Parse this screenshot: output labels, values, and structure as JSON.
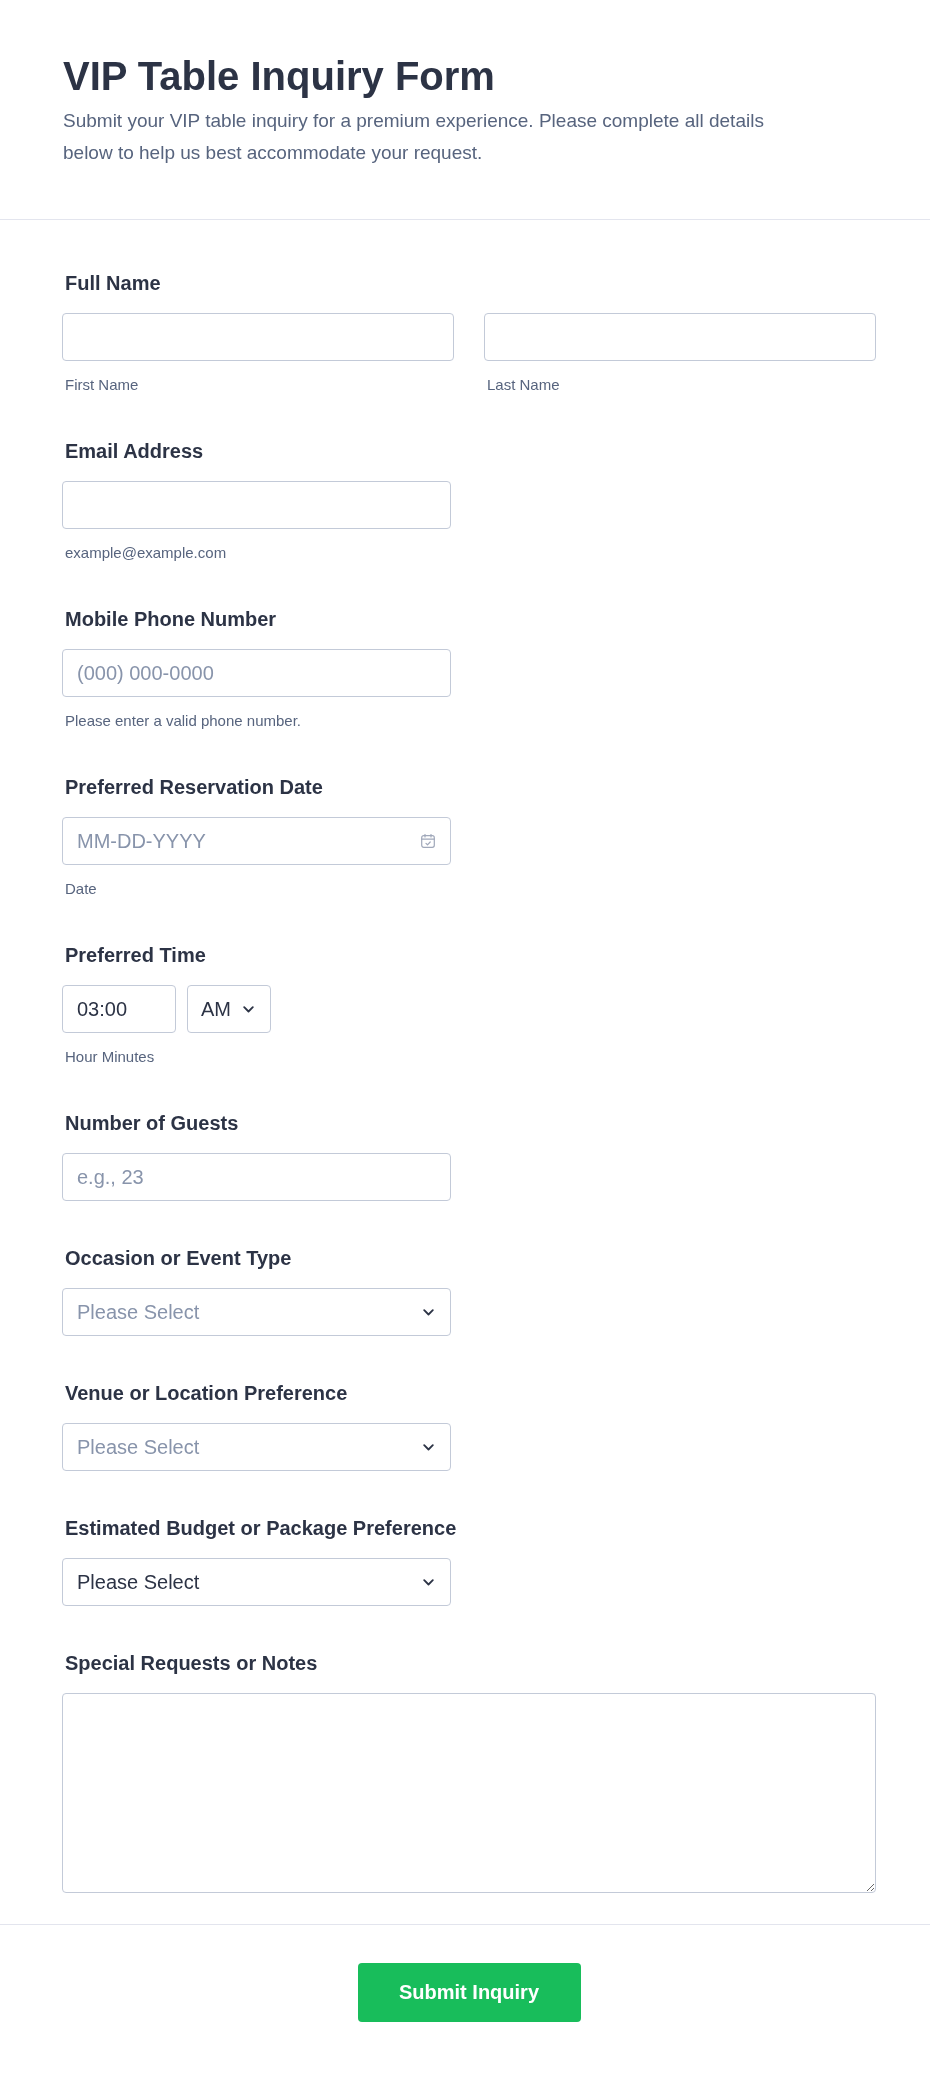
{
  "header": {
    "title": "VIP Table Inquiry Form",
    "description": "Submit your VIP table inquiry for a premium experience. Please complete all details below to help us best accommodate your request."
  },
  "fields": [
    {
      "kind": "name",
      "label": "Full Name",
      "inputs": [
        {
          "sublabel": "First Name"
        },
        {
          "sublabel": "Last Name"
        }
      ]
    },
    {
      "kind": "text",
      "label": "Email Address",
      "sublabel": "example@example.com"
    },
    {
      "kind": "text",
      "label": "Mobile Phone Number",
      "placeholder": "(000) 000-0000",
      "sublabel": "Please enter a valid phone number."
    },
    {
      "kind": "date",
      "label": "Preferred Reservation Date",
      "placeholder": "MM-DD-YYYY",
      "sublabel": "Date"
    },
    {
      "kind": "time",
      "label": "Preferred Time",
      "value": "03:00",
      "period": "AM",
      "sublabel": "Hour Minutes"
    },
    {
      "kind": "text",
      "label": "Number of Guests",
      "placeholder": "e.g., 23"
    },
    {
      "kind": "select",
      "label": "Occasion or Event Type",
      "placeholder": "Please Select"
    },
    {
      "kind": "select",
      "label": "Venue or Location Preference",
      "placeholder": "Please Select"
    },
    {
      "kind": "select",
      "label": "Estimated Budget or Package Preference",
      "value": "Please Select"
    },
    {
      "kind": "textarea",
      "label": "Special Requests or Notes"
    }
  ],
  "submit_button": "Submit Inquiry"
}
